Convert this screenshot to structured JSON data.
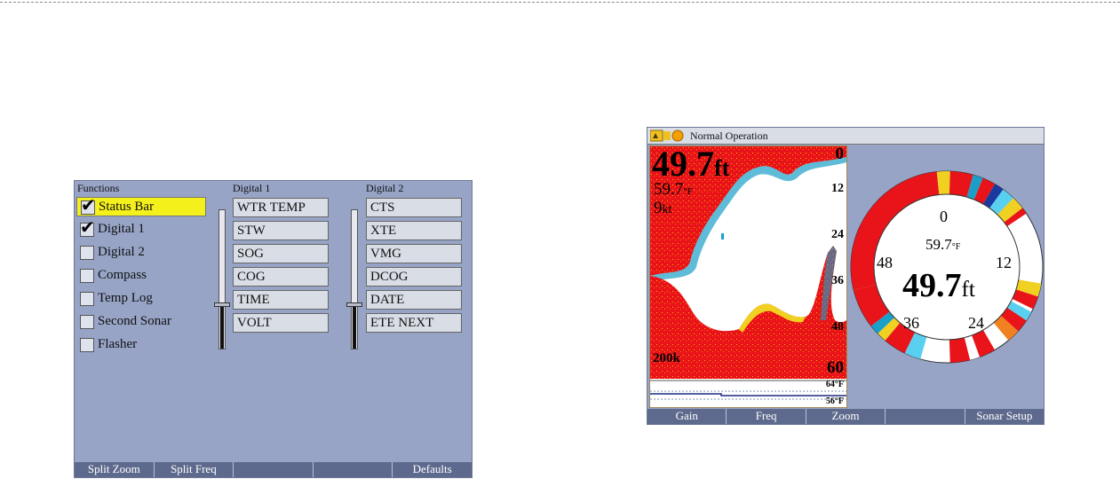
{
  "left_screen": {
    "headers": {
      "functions": "Functions",
      "digital1": "Digital 1",
      "digital2": "Digital 2"
    },
    "functions": [
      {
        "label": "Status Bar",
        "checked": true,
        "selected": true
      },
      {
        "label": "Digital 1",
        "checked": true,
        "selected": false
      },
      {
        "label": "Digital 2",
        "checked": false,
        "selected": false
      },
      {
        "label": "Compass",
        "checked": false,
        "selected": false
      },
      {
        "label": "Temp Log",
        "checked": false,
        "selected": false
      },
      {
        "label": "Second Sonar",
        "checked": false,
        "selected": false
      },
      {
        "label": "Flasher",
        "checked": false,
        "selected": false
      }
    ],
    "digital1_fields": [
      "WTR TEMP",
      "STW",
      "SOG",
      "COG",
      "TIME",
      "VOLT"
    ],
    "digital2_fields": [
      "CTS",
      "XTE",
      "VMG",
      "DCOG",
      "DATE",
      "ETE NEXT"
    ],
    "softkeys": [
      "Split Zoom",
      "Split Freq",
      "",
      "",
      "Defaults"
    ]
  },
  "right_screen": {
    "status_text": "Normal Operation",
    "depth_value": "49.7",
    "depth_unit": "ft",
    "water_temp": "59.7",
    "water_temp_unit": "°F",
    "speed_value": "9",
    "speed_unit": "kt",
    "depth_scale": [
      "0",
      "12",
      "24",
      "36",
      "48",
      "60"
    ],
    "frequency": "200k",
    "temp_graph_top": "64°F",
    "temp_graph_bottom": "56°F",
    "flasher": {
      "depth_value": "49.7",
      "depth_unit": "ft",
      "temp_value": "59.7",
      "temp_unit": "°F",
      "ring_labels": [
        "0",
        "12",
        "24",
        "36",
        "48"
      ]
    },
    "softkeys": [
      "Gain",
      "Freq",
      "Zoom",
      "",
      "Sonar Setup"
    ]
  },
  "colors": {
    "screen_bg": "#97a4c6",
    "selection": "#f4f01c",
    "softkey_bg": "#5e6a8d",
    "sonar_red": "#e8141a"
  }
}
